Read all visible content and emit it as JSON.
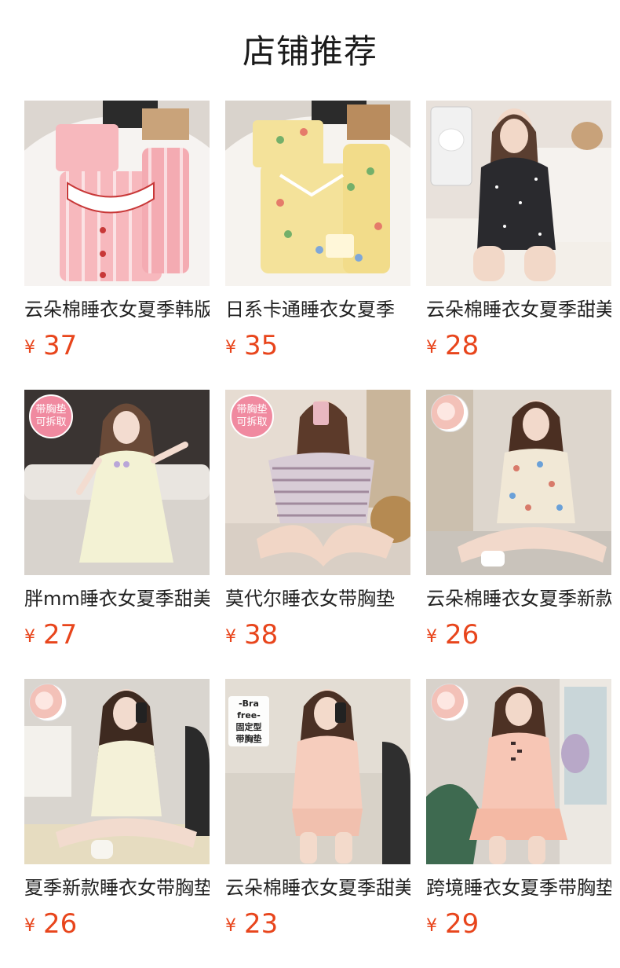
{
  "page": {
    "title": "店铺推荐"
  },
  "products": [
    {
      "name": "云朵棉睡衣女夏季韩版",
      "currency": "¥",
      "price": "37",
      "bg": "#f3e4df",
      "garment": "#f7b8bd",
      "badge": ""
    },
    {
      "name": "日系卡通睡衣女夏季",
      "currency": "¥",
      "price": "35",
      "bg": "#eee6d8",
      "garment": "#f3e08f",
      "badge": ""
    },
    {
      "name": "云朵棉睡衣女夏季甜美",
      "currency": "¥",
      "price": "28",
      "bg": "#ede7e3",
      "garment": "#2a2a2e",
      "badge": ""
    },
    {
      "name": "胖mm睡衣女夏季甜美",
      "currency": "¥",
      "price": "27",
      "bg": "#cfc9c3",
      "garment": "#f3f2d4",
      "badge": "带胸垫\n可拆取"
    },
    {
      "name": "莫代尔睡衣女带胸垫",
      "currency": "¥",
      "price": "38",
      "bg": "#e6dcd2",
      "garment": "#cfc3cf",
      "badge": "带胸垫\n可拆取"
    },
    {
      "name": "云朵棉睡衣女夏季新款",
      "currency": "¥",
      "price": "26",
      "bg": "#ddd6cd",
      "garment": "#f1e8d6",
      "badge": ""
    },
    {
      "name": "夏季新款睡衣女带胸垫",
      "currency": "¥",
      "price": "26",
      "bg": "#d9d5cf",
      "garment": "#f4f1d8",
      "badge": ""
    },
    {
      "name": "云朵棉睡衣女夏季甜美",
      "currency": "¥",
      "price": "23",
      "bg": "#d8d2c8",
      "garment": "#f6cdbd",
      "badge": "-Bra free-\n固定型\n带胸垫"
    },
    {
      "name": "跨境睡衣女夏季带胸垫",
      "currency": "¥",
      "price": "29",
      "bg": "#d8d2cb",
      "garment": "#f7c6b5",
      "badge": ""
    }
  ]
}
